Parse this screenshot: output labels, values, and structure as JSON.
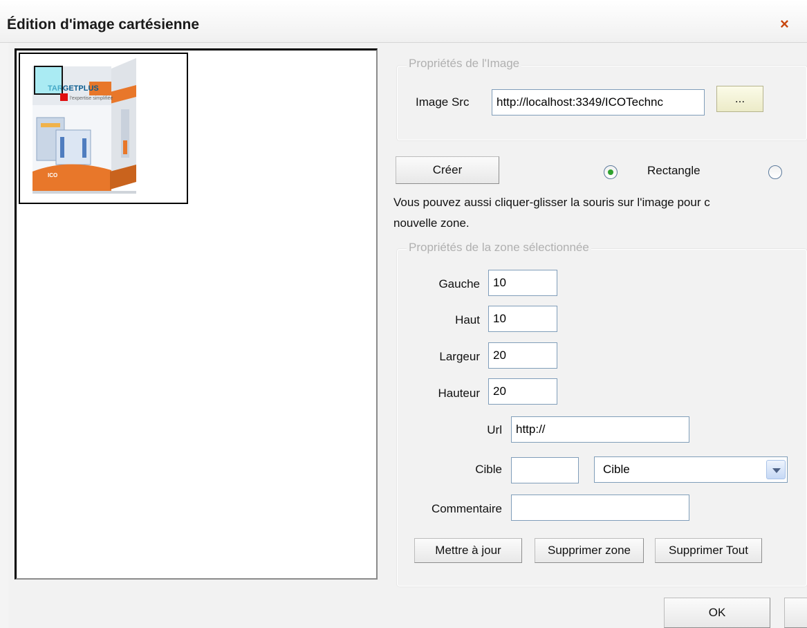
{
  "dialog": {
    "title": "Édition d'image cartésienne",
    "close_label": "×"
  },
  "image_props": {
    "legend": "Propriétés de l'Image",
    "src_label": "Image Src",
    "src_value": "http://localhost:3349/ICOTechnc",
    "browse_label": "..."
  },
  "shape": {
    "create_label": "Créer",
    "rectangle_label": "Rectangle",
    "rectangle_selected": true,
    "other_selected": false
  },
  "hint": {
    "line1": "Vous pouvez aussi cliquer-glisser la souris sur l'image pour c",
    "line2": "nouvelle zone."
  },
  "zone": {
    "legend": "Propriétés de la zone sélectionnée",
    "left_label": "Gauche",
    "left_value": "10",
    "top_label": "Haut",
    "top_value": "10",
    "width_label": "Largeur",
    "width_value": "20",
    "height_label": "Hauteur",
    "height_value": "20",
    "url_label": "Url",
    "url_value": "http://",
    "target_label": "Cible",
    "target_value": "",
    "target_select": "Cible",
    "comment_label": "Commentaire",
    "comment_value": "",
    "update_label": "Mettre à jour",
    "delete_zone_label": "Supprimer zone",
    "delete_all_label": "Supprimer Tout"
  },
  "footer": {
    "ok_label": "OK"
  },
  "colors": {
    "close": "#c8460e",
    "radio_dot": "#2fa22f",
    "selection_fill": "#78ebf5",
    "selection_handle": "#e01010",
    "box_orange": "#e8772a",
    "box_silver": "#dfe3e8"
  },
  "image_thumbnail": {
    "logo_text": "TARGETPLUS",
    "tagline": "l'expertise simplifiée",
    "side_text": "TargetPLUS",
    "brand": "ICO"
  }
}
